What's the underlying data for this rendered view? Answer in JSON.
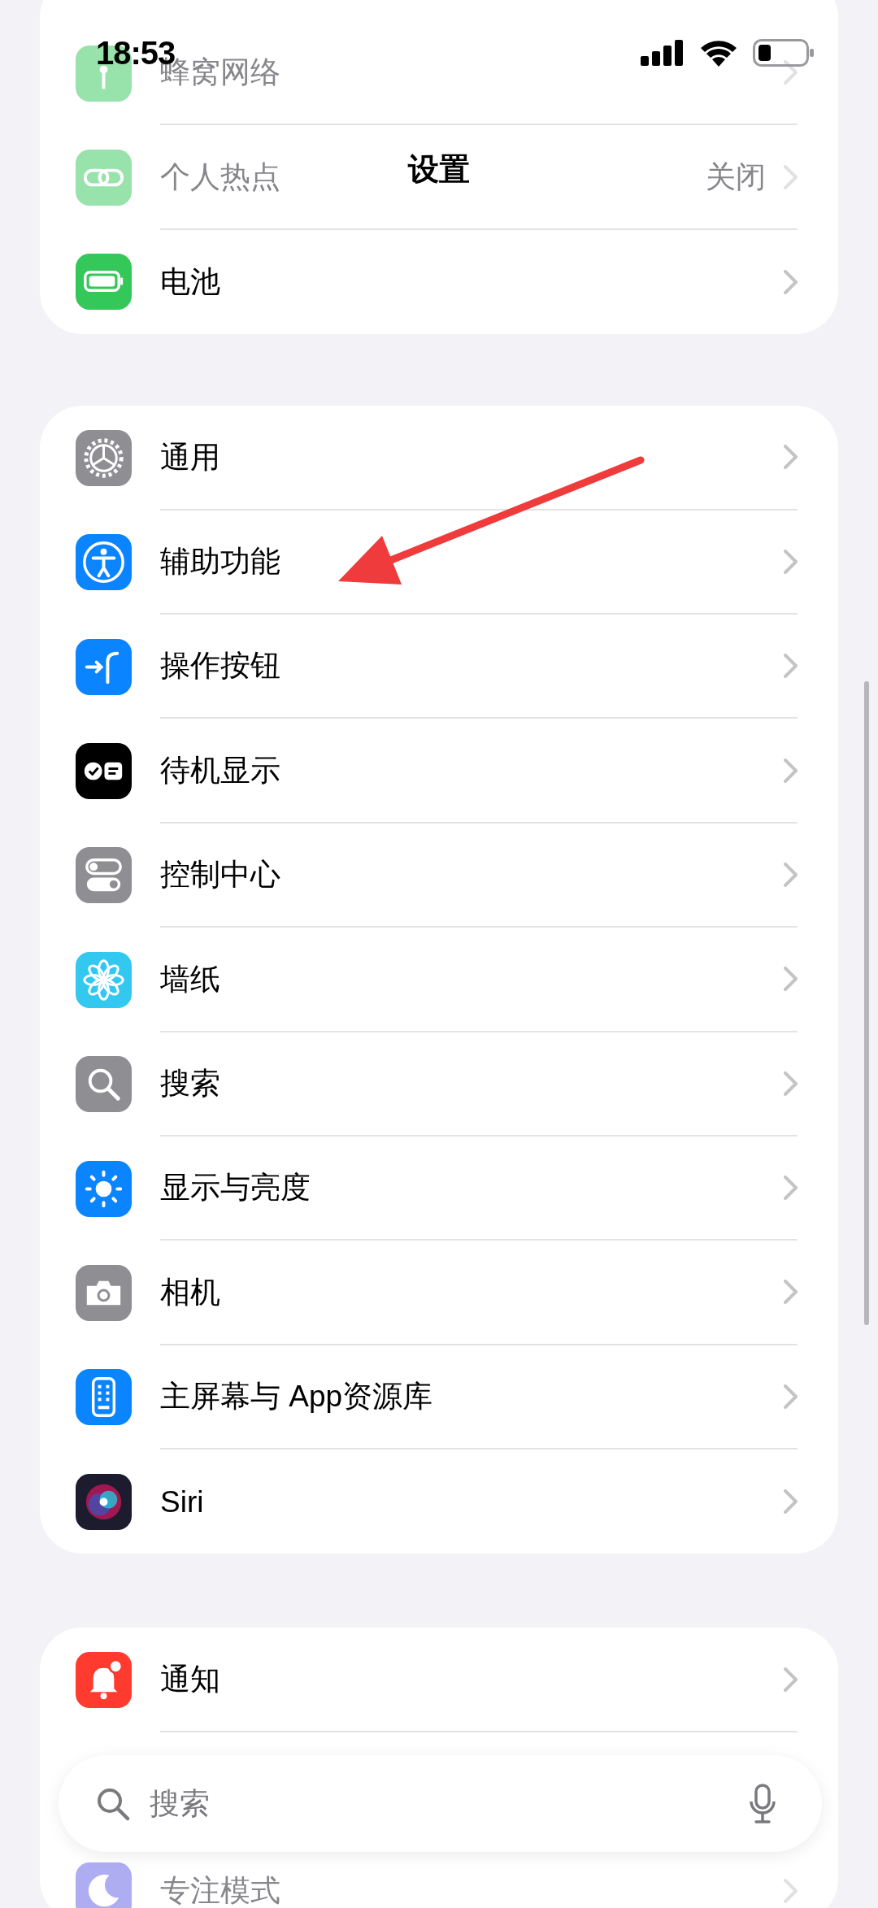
{
  "status_bar": {
    "time": "18:53"
  },
  "navigation": {
    "title": "设置"
  },
  "sections": [
    {
      "rows": [
        {
          "label": "蜂窝网络",
          "dimmed": true
        },
        {
          "label": "个人热点",
          "value": "关闭",
          "dimmed": true
        },
        {
          "label": "电池",
          "dimmed": false
        }
      ]
    },
    {
      "rows": [
        {
          "label": "通用",
          "dimmed": false
        },
        {
          "label": "辅助功能",
          "dimmed": false
        },
        {
          "label": "操作按钮",
          "dimmed": false
        },
        {
          "label": "待机显示",
          "dimmed": false
        },
        {
          "label": "控制中心",
          "dimmed": false
        },
        {
          "label": "墙纸",
          "dimmed": false
        },
        {
          "label": "搜索",
          "dimmed": false
        },
        {
          "label": "显示与亮度",
          "dimmed": false
        },
        {
          "label": "相机",
          "dimmed": false
        },
        {
          "label": "主屏幕与 App资源库",
          "dimmed": false
        },
        {
          "label": "Siri",
          "dimmed": false
        }
      ]
    },
    {
      "rows": [
        {
          "label": "通知",
          "dimmed": false
        },
        {
          "label": "专注模式",
          "dimmed": true
        }
      ]
    }
  ],
  "search_bar": {
    "placeholder": "搜索"
  }
}
